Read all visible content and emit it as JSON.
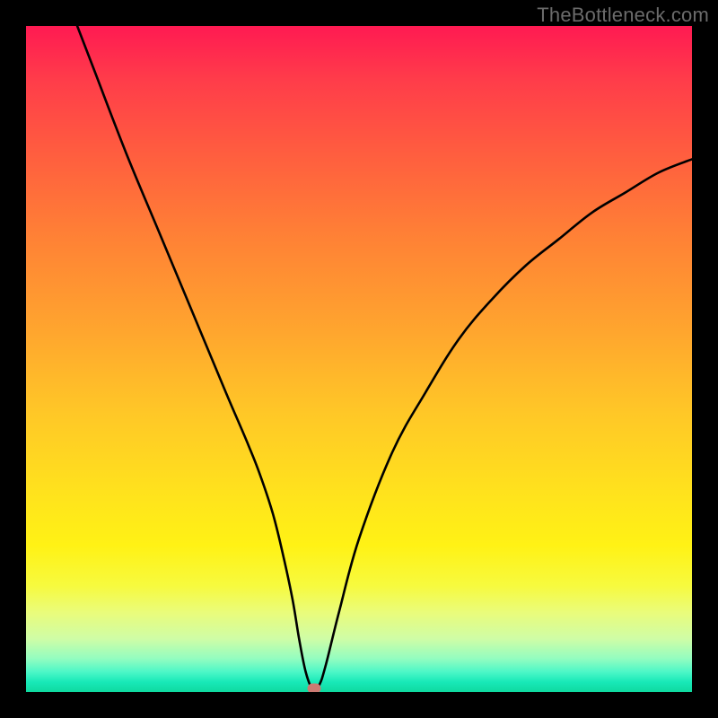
{
  "watermark": "TheBottleneck.com",
  "chart_data": {
    "type": "line",
    "title": "",
    "xlabel": "",
    "ylabel": "",
    "xlim": [
      0,
      100
    ],
    "ylim": [
      0,
      100
    ],
    "categories": [
      0,
      5,
      10,
      15,
      20,
      25,
      30,
      33,
      35,
      37,
      38.5,
      40,
      41,
      42,
      43,
      44,
      45,
      47,
      50,
      55,
      60,
      65,
      70,
      75,
      80,
      85,
      90,
      95,
      100
    ],
    "values": [
      120,
      107,
      94,
      81,
      69,
      57,
      45,
      38,
      33,
      27,
      21,
      14,
      8,
      3,
      0.5,
      1,
      4,
      12,
      23,
      36,
      45,
      53,
      59,
      64,
      68,
      72,
      75,
      78,
      80
    ],
    "marker": {
      "x": 43.2,
      "y": 0.6
    },
    "gradient_stops": [
      {
        "pos": 0.0,
        "color": "#ff1a52"
      },
      {
        "pos": 0.5,
        "color": "#ffb82a"
      },
      {
        "pos": 0.78,
        "color": "#fff215"
      },
      {
        "pos": 1.0,
        "color": "#0fd99f"
      }
    ]
  }
}
